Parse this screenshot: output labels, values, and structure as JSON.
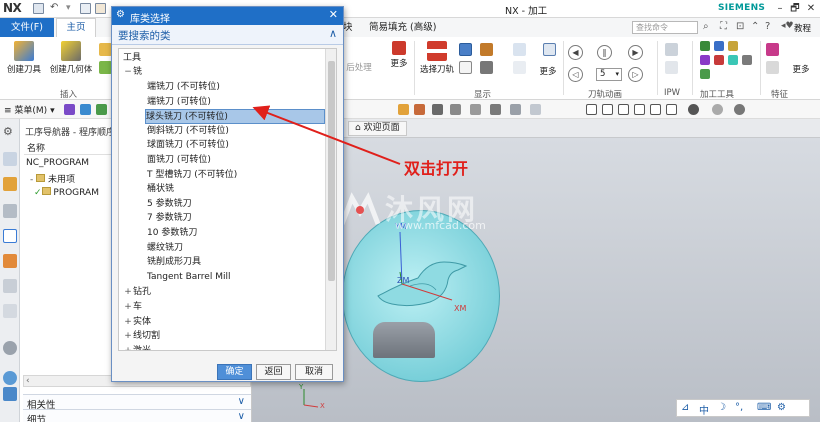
{
  "titlebar": {
    "logo": "NX",
    "window_title": "NX - 加工",
    "brand": "SIEMENS",
    "minimize": "–",
    "restore": "🗗",
    "close": "✕"
  },
  "ribbon": {
    "tabs": [
      "文件(F)",
      "主页",
      "简易填充 (高级)"
    ],
    "tab_partial": "块",
    "search_placeholder": "查找命令",
    "tutorial": "教程",
    "buttons": {
      "create_tool": "创建刀具",
      "create_geometry": "创建几何体",
      "reprocess": "后处理",
      "more1": "更多",
      "select_toolpath": "选择刀轨",
      "more2": "更多",
      "more3": "更多"
    },
    "groups": {
      "insert": "插入",
      "display": "显示",
      "toolpath_animation": "刀轨动画",
      "ipw": "IPW",
      "machining_tools": "加工工具",
      "features": "特征"
    },
    "animation_speed": "5"
  },
  "toolbar2": {
    "menu": "菜单(M)"
  },
  "navigator": {
    "title": "工序导航器 - 程序顺序",
    "column_name": "名称",
    "rows": [
      "NC_PROGRAM",
      "未用项",
      "PROGRAM"
    ],
    "panels": [
      "相关性",
      "细节"
    ]
  },
  "graphics": {
    "welcome_tab": "欢迎页面",
    "axis_labels": [
      "YM",
      "ZM",
      "XM"
    ],
    "triad_labels": [
      "Y",
      "X"
    ]
  },
  "dialog": {
    "title": "库类选择",
    "section": "要搜索的类",
    "root": "工具",
    "milling": "铣",
    "items": [
      "端铣刀 (不可转位)",
      "端铣刀 (可转位)",
      "球头铣刀 (不可转位)",
      "倒斜铣刀 (不可转位)",
      "球面铣刀 (不可转位)",
      "面铣刀 (可转位)",
      "T 型槽铣刀 (不可转位)",
      "桶状铣",
      "5 参数铣刀",
      "7 参数铣刀",
      "10 参数铣刀",
      "螺纹铣刀",
      "铣削成形刀具",
      "Tangent Barrel Mill"
    ],
    "selected_index": 2,
    "other_groups": [
      "钻孔",
      "车",
      "实体",
      "线切割",
      "激光"
    ],
    "buttons": {
      "ok": "确定",
      "back": "返回",
      "cancel": "取消"
    }
  },
  "annotation": {
    "text": "双击打开",
    "color": "#e0201b"
  },
  "watermark": {
    "main": "沐风网",
    "url": "www.mfcad.com"
  },
  "ime_bar": [
    "中",
    "☽",
    "°,",
    "⌨",
    "⚙"
  ],
  "colors": {
    "accent": "#1f6fc7",
    "selection": "#a8c7e8",
    "model": "#5fc3cf"
  }
}
